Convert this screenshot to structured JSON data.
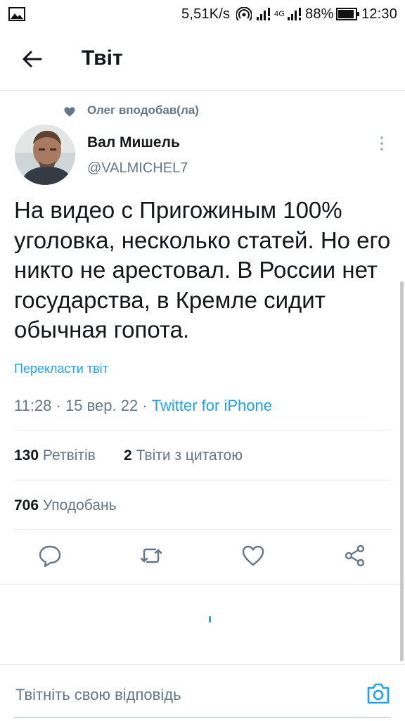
{
  "status_bar": {
    "speed": "5,51K/s",
    "network": "4G",
    "battery": "88%",
    "time": "12:30",
    "icons": [
      "gallery-icon",
      "hotspot-icon",
      "signal-icon",
      "signal-4g-icon",
      "battery-icon"
    ]
  },
  "header": {
    "title": "Твіт",
    "back_icon": "arrow-left-icon"
  },
  "tweet": {
    "social_context": "Олег вподобав(ла)",
    "author_name": "Вал Мишель",
    "author_handle": "@VALMICHEL7",
    "text": "На видео с Пригожиным 100% уголовка, несколько статей. Но его никто не арестовал. В России нет государства, в Кремле сидит обычная гопота.",
    "translate_label": "Перекласти твіт",
    "time": "11:28",
    "date": "15 вер. 22",
    "source": "Twitter for iPhone",
    "separator": "·"
  },
  "stats": {
    "retweets_count": "130",
    "retweets_label": "Ретвітів",
    "quotes_count": "2",
    "quotes_label": "Твіти з цитатою",
    "likes_count": "706",
    "likes_label": "Уподобань"
  },
  "actions": [
    "reply-icon",
    "retweet-icon",
    "like-icon",
    "share-icon"
  ],
  "reply_bar": {
    "placeholder": "Твітніть свою відповідь",
    "camera_icon": "camera-icon"
  },
  "colors": {
    "accent": "#1da1f2",
    "secondary_text": "#657786",
    "primary_text": "#14171a",
    "divider": "#e6ecf0"
  }
}
